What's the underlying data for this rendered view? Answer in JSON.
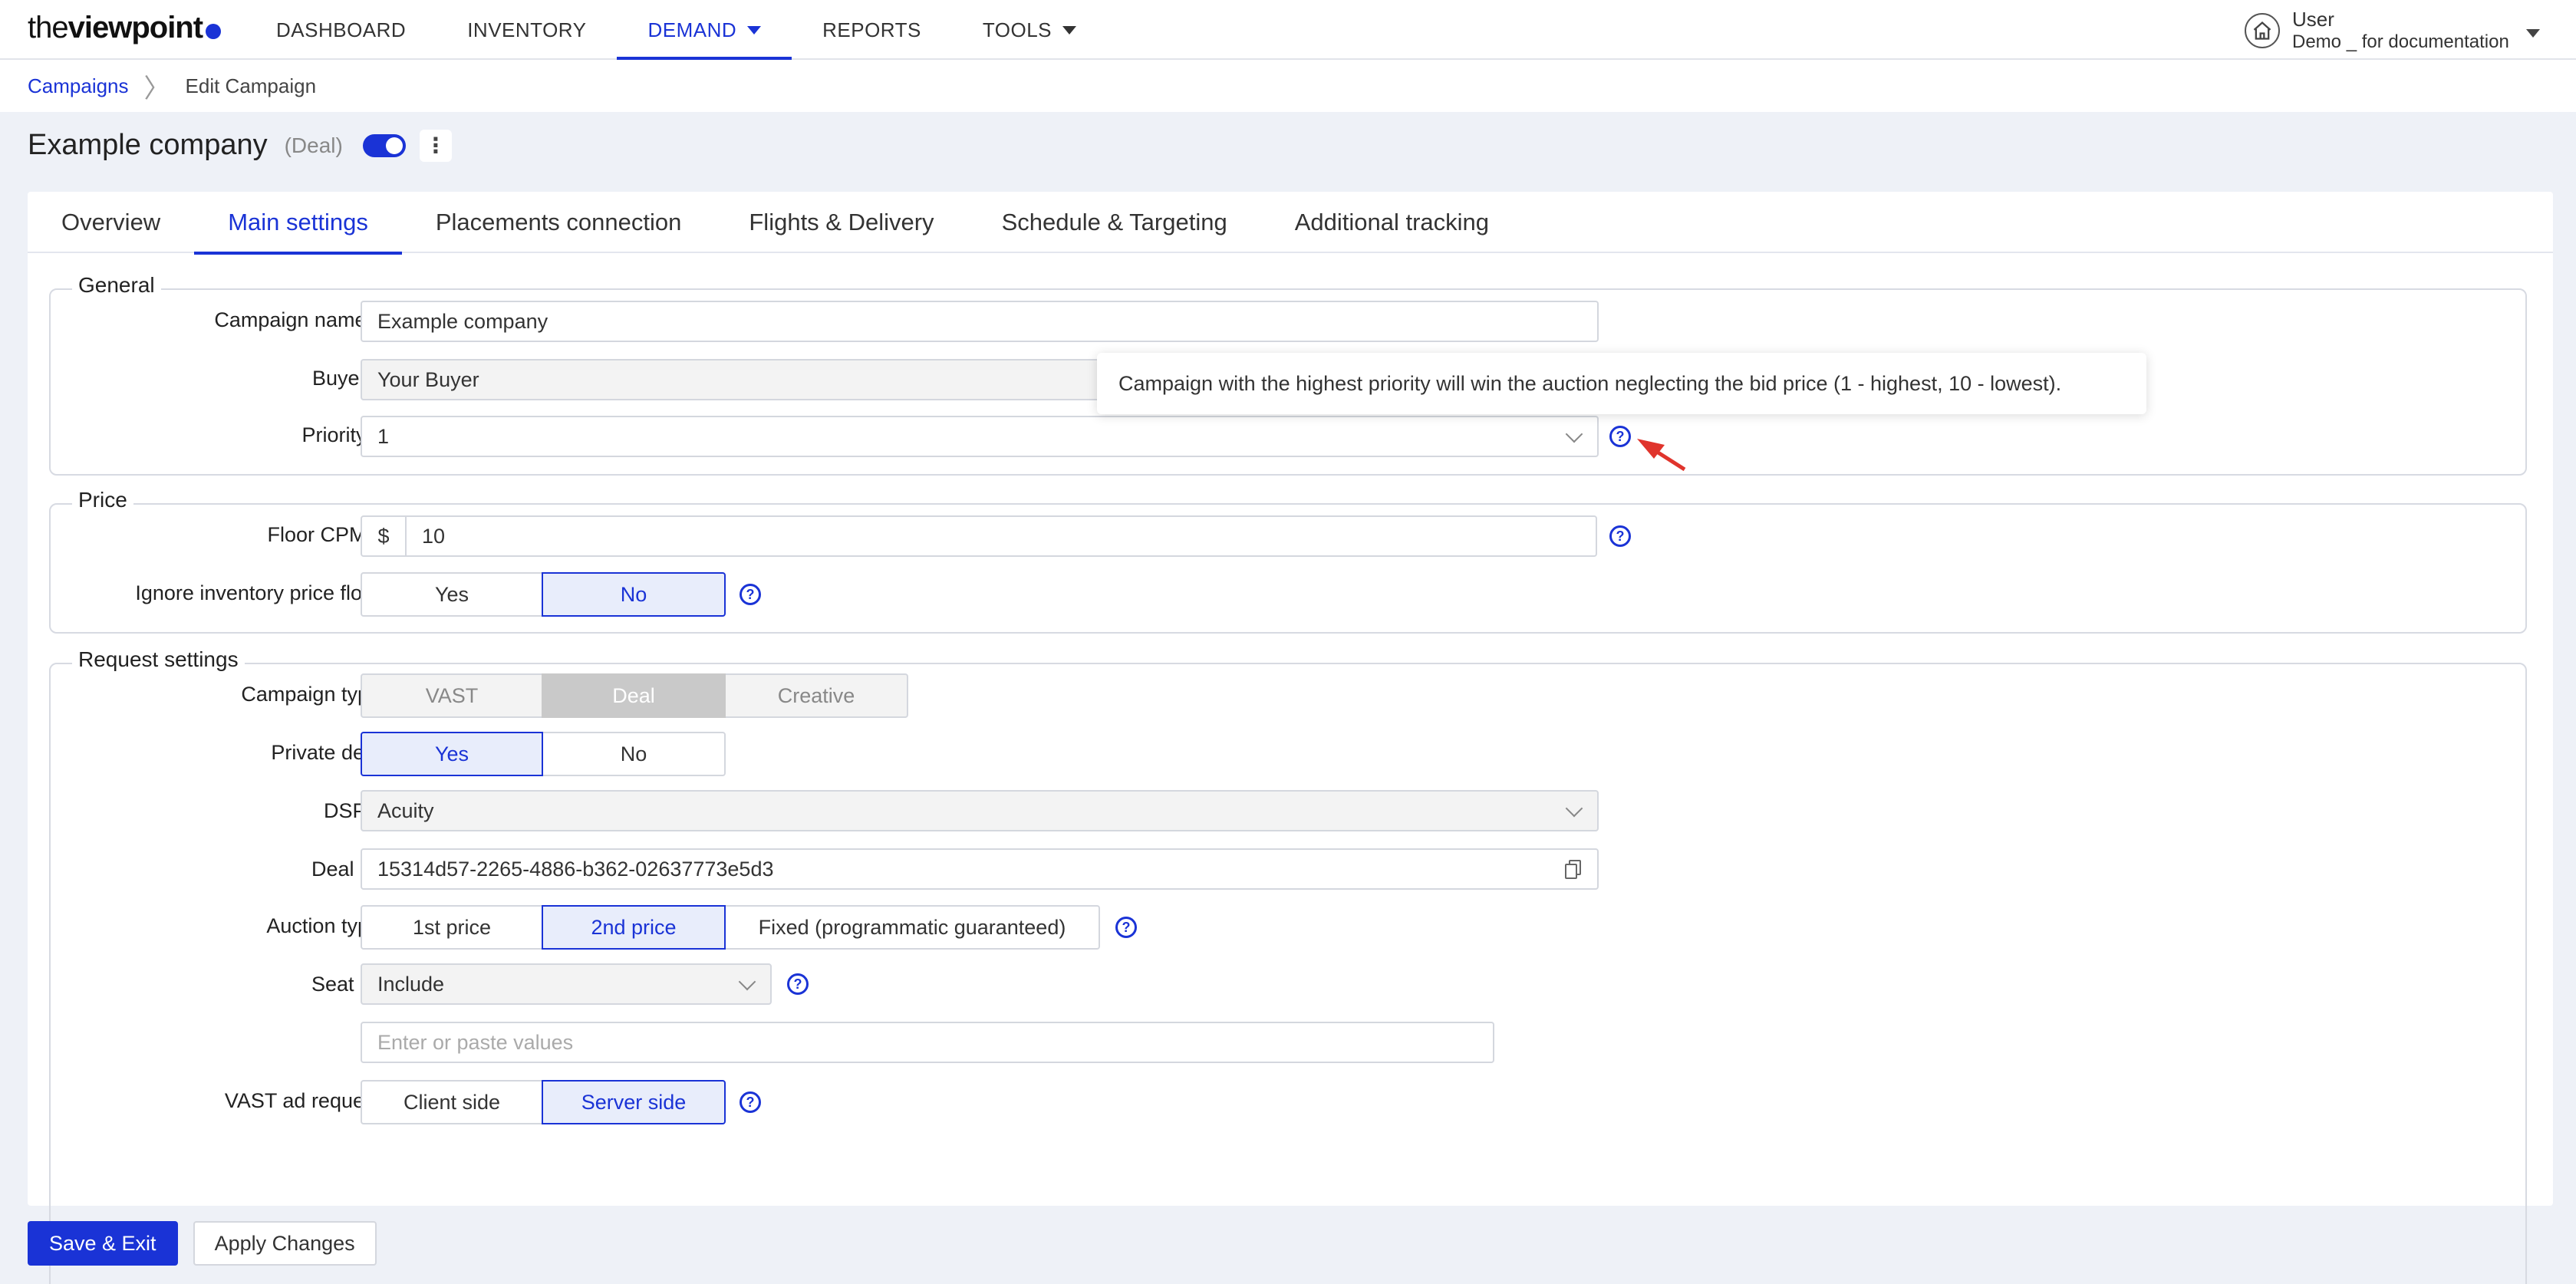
{
  "logo": {
    "light": "the",
    "bold": "viewpoint"
  },
  "nav": [
    {
      "label": "DASHBOARD"
    },
    {
      "label": "INVENTORY"
    },
    {
      "label": "DEMAND"
    },
    {
      "label": "REPORTS"
    },
    {
      "label": "TOOLS"
    }
  ],
  "user": {
    "name": "User",
    "org": "Demo _ for documentation"
  },
  "breadcrumb": {
    "root": "Campaigns",
    "current": "Edit Campaign"
  },
  "title": {
    "name": "Example company",
    "type": "(Deal)"
  },
  "tabs": [
    {
      "label": "Overview"
    },
    {
      "label": "Main settings"
    },
    {
      "label": "Placements connection"
    },
    {
      "label": "Flights & Delivery"
    },
    {
      "label": "Schedule & Targeting"
    },
    {
      "label": "Additional tracking"
    }
  ],
  "general": {
    "legend": "General",
    "campaign_name_label": "Campaign name",
    "campaign_name_value": "Example company",
    "buyer_label": "Buyer",
    "buyer_value": "Your Buyer",
    "priority_label": "Priority",
    "priority_value": "1"
  },
  "tooltip": "Campaign with the highest priority will win the auction neglecting the bid price (1 - highest, 10 - lowest).",
  "price": {
    "legend": "Price",
    "floor_label": "Floor CPM",
    "currency": "$",
    "floor_value": "10",
    "ignore_label": "Ignore inventory price floor",
    "yes": "Yes",
    "no": "No"
  },
  "request": {
    "legend": "Request settings",
    "campaign_type_label": "Campaign type",
    "types": [
      "VAST",
      "Deal",
      "Creative"
    ],
    "private_label": "Private deal",
    "yes": "Yes",
    "no": "No",
    "dsp_label": "DSP",
    "dsp_value": "Acuity",
    "deal_id_label": "Deal ID",
    "deal_id_value": "15314d57-2265-4886-b362-02637773e5d3",
    "auction_label": "Auction type",
    "auction_opts": [
      "1st price",
      "2nd price",
      "Fixed (programmatic guaranteed)"
    ],
    "seat_label": "Seat ID",
    "seat_value": "Include",
    "seat_placeholder": "Enter or paste values",
    "vast_label": "VAST ad request",
    "vast_opts": [
      "Client side",
      "Server side"
    ]
  },
  "help_glyph": "?",
  "footer": {
    "save": "Save & Exit",
    "apply": "Apply Changes"
  }
}
